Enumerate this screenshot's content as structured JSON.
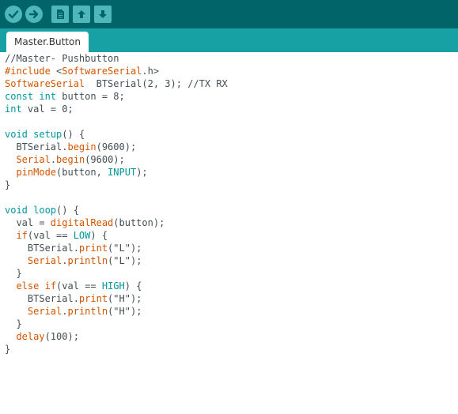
{
  "toolbar": {
    "buttons": [
      {
        "name": "verify-button",
        "icon": "checkmark-icon"
      },
      {
        "name": "upload-button",
        "icon": "arrow-right-icon"
      },
      {
        "name": "new-button",
        "icon": "document-icon"
      },
      {
        "name": "open-button",
        "icon": "arrow-up-icon"
      },
      {
        "name": "save-button",
        "icon": "arrow-down-icon"
      }
    ],
    "colors": {
      "toolbar_bg": "#006468",
      "button_bg": "#4db7bb",
      "tabbar_bg": "#17a1a5"
    }
  },
  "tabs": [
    {
      "label": "Master.Button",
      "active": true
    }
  ],
  "editor": {
    "lines": [
      {
        "tokens": [
          {
            "t": "//Master- Pushbutton",
            "c": "gray"
          }
        ]
      },
      {
        "tokens": [
          {
            "t": "#include",
            "c": "orange"
          },
          {
            "t": " <",
            "c": "gray"
          },
          {
            "t": "SoftwareSerial",
            "c": "orange"
          },
          {
            "t": ".h>",
            "c": "gray"
          }
        ]
      },
      {
        "tokens": [
          {
            "t": "SoftwareSerial",
            "c": "orange"
          },
          {
            "t": "  BTSerial(2, 3); //TX RX",
            "c": "gray"
          }
        ]
      },
      {
        "tokens": [
          {
            "t": "const",
            "c": "teal"
          },
          {
            "t": " ",
            "c": "gray"
          },
          {
            "t": "int",
            "c": "teal"
          },
          {
            "t": " button = 8;",
            "c": "gray"
          }
        ]
      },
      {
        "tokens": [
          {
            "t": "int",
            "c": "teal"
          },
          {
            "t": " val = 0;",
            "c": "gray"
          }
        ]
      },
      {
        "tokens": []
      },
      {
        "tokens": [
          {
            "t": "void",
            "c": "teal"
          },
          {
            "t": " ",
            "c": "gray"
          },
          {
            "t": "setup",
            "c": "teal"
          },
          {
            "t": "() {",
            "c": "gray"
          }
        ]
      },
      {
        "tokens": [
          {
            "t": "  BTSerial.",
            "c": "gray"
          },
          {
            "t": "begin",
            "c": "orange"
          },
          {
            "t": "(9600);",
            "c": "gray"
          }
        ]
      },
      {
        "tokens": [
          {
            "t": "  ",
            "c": "gray"
          },
          {
            "t": "Serial",
            "c": "orange"
          },
          {
            "t": ".",
            "c": "gray"
          },
          {
            "t": "begin",
            "c": "orange"
          },
          {
            "t": "(9600);",
            "c": "gray"
          }
        ]
      },
      {
        "tokens": [
          {
            "t": "  ",
            "c": "gray"
          },
          {
            "t": "pinMode",
            "c": "orange"
          },
          {
            "t": "(button, ",
            "c": "gray"
          },
          {
            "t": "INPUT",
            "c": "teal"
          },
          {
            "t": ");",
            "c": "gray"
          }
        ]
      },
      {
        "tokens": [
          {
            "t": "}",
            "c": "gray"
          }
        ]
      },
      {
        "tokens": []
      },
      {
        "tokens": [
          {
            "t": "void",
            "c": "teal"
          },
          {
            "t": " ",
            "c": "gray"
          },
          {
            "t": "loop",
            "c": "teal"
          },
          {
            "t": "() {",
            "c": "gray"
          }
        ]
      },
      {
        "tokens": [
          {
            "t": "  val = ",
            "c": "gray"
          },
          {
            "t": "digitalRead",
            "c": "orange"
          },
          {
            "t": "(button);",
            "c": "gray"
          }
        ]
      },
      {
        "tokens": [
          {
            "t": "  ",
            "c": "gray"
          },
          {
            "t": "if",
            "c": "orange"
          },
          {
            "t": "(val == ",
            "c": "gray"
          },
          {
            "t": "LOW",
            "c": "teal"
          },
          {
            "t": ") {",
            "c": "gray"
          }
        ]
      },
      {
        "tokens": [
          {
            "t": "    BTSerial.",
            "c": "gray"
          },
          {
            "t": "print",
            "c": "orange"
          },
          {
            "t": "(\"L\");",
            "c": "gray"
          }
        ]
      },
      {
        "tokens": [
          {
            "t": "    ",
            "c": "gray"
          },
          {
            "t": "Serial",
            "c": "orange"
          },
          {
            "t": ".",
            "c": "gray"
          },
          {
            "t": "println",
            "c": "orange"
          },
          {
            "t": "(\"L\");",
            "c": "gray"
          }
        ]
      },
      {
        "tokens": [
          {
            "t": "  }",
            "c": "gray"
          }
        ]
      },
      {
        "tokens": [
          {
            "t": "  ",
            "c": "gray"
          },
          {
            "t": "else",
            "c": "orange"
          },
          {
            "t": " ",
            "c": "gray"
          },
          {
            "t": "if",
            "c": "orange"
          },
          {
            "t": "(val == ",
            "c": "gray"
          },
          {
            "t": "HIGH",
            "c": "teal"
          },
          {
            "t": ") {",
            "c": "gray"
          }
        ]
      },
      {
        "tokens": [
          {
            "t": "    BTSerial.",
            "c": "gray"
          },
          {
            "t": "print",
            "c": "orange"
          },
          {
            "t": "(\"H\");",
            "c": "gray"
          }
        ]
      },
      {
        "tokens": [
          {
            "t": "    ",
            "c": "gray"
          },
          {
            "t": "Serial",
            "c": "orange"
          },
          {
            "t": ".",
            "c": "gray"
          },
          {
            "t": "println",
            "c": "orange"
          },
          {
            "t": "(\"H\");",
            "c": "gray"
          }
        ]
      },
      {
        "tokens": [
          {
            "t": "  }",
            "c": "gray"
          }
        ]
      },
      {
        "tokens": [
          {
            "t": "  ",
            "c": "gray"
          },
          {
            "t": "delay",
            "c": "orange"
          },
          {
            "t": "(100);",
            "c": "gray"
          }
        ]
      },
      {
        "tokens": [
          {
            "t": "}",
            "c": "gray"
          }
        ]
      }
    ]
  }
}
